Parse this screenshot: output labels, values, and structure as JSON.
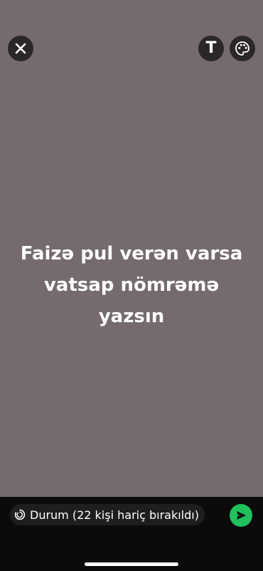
{
  "status_editor": {
    "text": "Faizə pul verən varsa\nvatsap nömrəmə\nyazsın",
    "background_color": "#756a6d",
    "toolbar": {
      "close_icon": "close-icon",
      "text_tool_label": "T",
      "palette_icon": "palette-icon"
    }
  },
  "bottom_bar": {
    "audience_icon": "status-ring-icon",
    "audience_label": "Durum (22 kişi hariç bırakıldı)",
    "send_icon": "send-icon",
    "send_color": "#20c05c"
  }
}
